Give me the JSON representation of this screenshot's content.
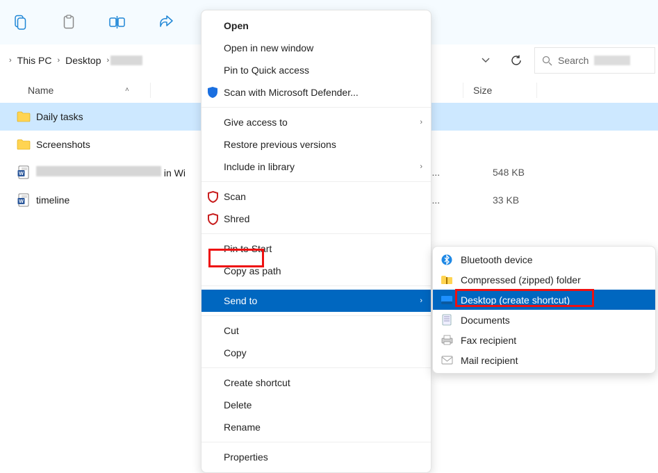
{
  "toolbar": {
    "icons": [
      "copy-icon",
      "paste-icon",
      "rename-icon",
      "share-icon",
      "delete-icon"
    ]
  },
  "breadcrumb": {
    "segments": [
      "This PC",
      "Desktop"
    ],
    "last_redacted": true
  },
  "search": {
    "label": "Search",
    "placeholder_redacted": true
  },
  "columns": {
    "name": "Name",
    "size": "Size",
    "sort_dir": "asc"
  },
  "rows": [
    {
      "name": "Daily tasks",
      "icon": "folder",
      "selected": true
    },
    {
      "name": "Screenshots",
      "icon": "folder"
    },
    {
      "name_redacted_prefix": true,
      "name_suffix": " in Wi",
      "icon": "word",
      "type_trunc": "rd D...",
      "size": "548 KB"
    },
    {
      "name": "timeline",
      "icon": "word",
      "type_trunc": "rd D...",
      "size": "33 KB"
    }
  ],
  "context_menu": {
    "items": [
      {
        "label": "Open",
        "bold": true
      },
      {
        "label": "Open in new window"
      },
      {
        "label": "Pin to Quick access"
      },
      {
        "label": "Scan with Microsoft Defender...",
        "icon": "shield"
      },
      {
        "sep": true
      },
      {
        "label": "Give access to",
        "submenu": true
      },
      {
        "label": "Restore previous versions"
      },
      {
        "label": "Include in library",
        "submenu": true
      },
      {
        "sep": true
      },
      {
        "label": "Scan",
        "icon": "mcafee"
      },
      {
        "label": "Shred",
        "icon": "mcafee"
      },
      {
        "sep": true
      },
      {
        "label": "Pin to Start"
      },
      {
        "label": "Copy as path"
      },
      {
        "sep": true
      },
      {
        "label": "Send to",
        "submenu": true,
        "highlight": true,
        "red_box": true
      },
      {
        "sep": true
      },
      {
        "label": "Cut"
      },
      {
        "label": "Copy"
      },
      {
        "sep": true
      },
      {
        "label": "Create shortcut"
      },
      {
        "label": "Delete"
      },
      {
        "label": "Rename"
      },
      {
        "sep": true
      },
      {
        "label": "Properties"
      }
    ]
  },
  "submenu": {
    "items": [
      {
        "label": "Bluetooth device",
        "icon": "bluetooth"
      },
      {
        "label": "Compressed (zipped) folder",
        "icon": "zip"
      },
      {
        "label": "Desktop (create shortcut)",
        "icon": "desktop",
        "highlight": true,
        "red_box": true
      },
      {
        "label": "Documents",
        "icon": "doc"
      },
      {
        "label": "Fax recipient",
        "icon": "fax"
      },
      {
        "label": "Mail recipient",
        "icon": "mail"
      }
    ]
  },
  "colors": {
    "accent": "#0067c0",
    "selection": "#cde8ff",
    "highlight_box": "#e11"
  }
}
